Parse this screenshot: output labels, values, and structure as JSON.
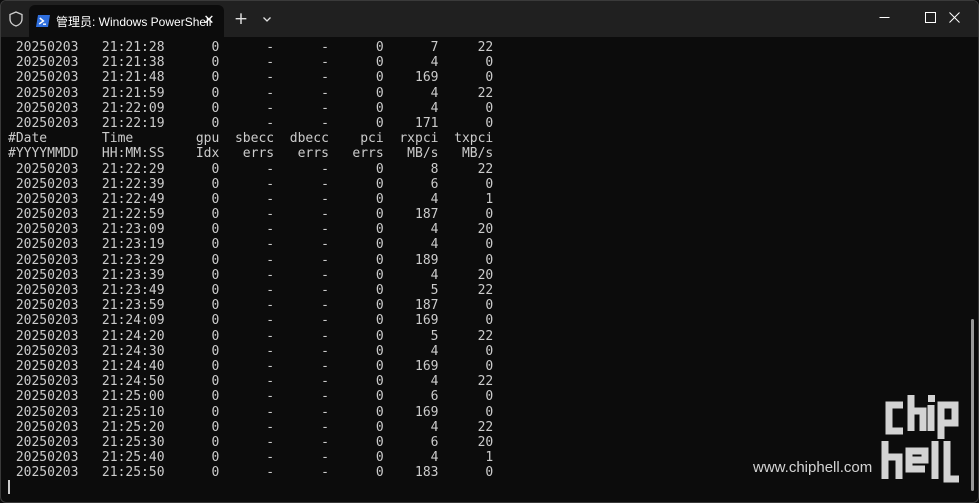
{
  "window": {
    "tab_title": "管理员: Windows PowerShell",
    "icons": {
      "shield": "shield-icon",
      "tab_app": "powershell-icon",
      "tab_close": "close-icon",
      "new_tab": "plus-icon",
      "dropdown": "chevron-down-icon",
      "minimize": "minimize-icon",
      "maximize": "maximize-icon",
      "close": "close-icon"
    },
    "new_tab_glyph": "+",
    "tab_close_glyph": "✕",
    "colors": {
      "titlebar": "#202020",
      "terminal_bg": "#0c0c0c",
      "terminal_fg": "#cccccc",
      "accent": "#2f6fde"
    }
  },
  "terminal": {
    "lines": [
      " 20250203   21:21:28      0      -      -      0      7     22",
      " 20250203   21:21:38      0      -      -      0      4      0",
      " 20250203   21:21:48      0      -      -      0    169      0",
      " 20250203   21:21:59      0      -      -      0      4     22",
      " 20250203   21:22:09      0      -      -      0      4      0",
      " 20250203   21:22:19      0      -      -      0    171      0",
      "#Date       Time        gpu  sbecc  dbecc    pci  rxpci  txpci",
      "#YYYYMMDD   HH:MM:SS    Idx   errs   errs   errs   MB/s   MB/s",
      " 20250203   21:22:29      0      -      -      0      8     22",
      " 20250203   21:22:39      0      -      -      0      6      0",
      " 20250203   21:22:49      0      -      -      0      4      1",
      " 20250203   21:22:59      0      -      -      0    187      0",
      " 20250203   21:23:09      0      -      -      0      4     20",
      " 20250203   21:23:19      0      -      -      0      4      0",
      " 20250203   21:23:29      0      -      -      0    189      0",
      " 20250203   21:23:39      0      -      -      0      4     20",
      " 20250203   21:23:49      0      -      -      0      5     22",
      " 20250203   21:23:59      0      -      -      0    187      0",
      " 20250203   21:24:09      0      -      -      0    169      0",
      " 20250203   21:24:20      0      -      -      0      5     22",
      " 20250203   21:24:30      0      -      -      0      4      0",
      " 20250203   21:24:40      0      -      -      0    169      0",
      " 20250203   21:24:50      0      -      -      0      4     22",
      " 20250203   21:25:00      0      -      -      0      6      0",
      " 20250203   21:25:10      0      -      -      0    169      0",
      " 20250203   21:25:20      0      -      -      0      4     22",
      " 20250203   21:25:30      0      -      -      0      6     20",
      " 20250203   21:25:40      0      -      -      0      4      1",
      " 20250203   21:25:50      0      -      -      0    183      0"
    ]
  },
  "watermark": {
    "site": "www.chiphell.com",
    "logo_text": "chiphell"
  }
}
